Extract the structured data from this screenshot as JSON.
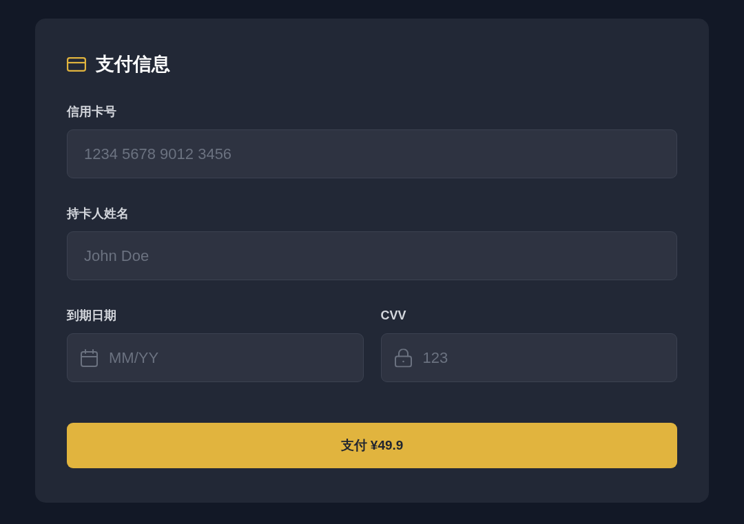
{
  "card": {
    "title": "支付信息",
    "rows": [
      {
        "fields": [
          {
            "label": "信用卡号",
            "placeholder": "1234 5678 9012 3456",
            "kind": "text"
          }
        ]
      },
      {
        "fields": [
          {
            "label": "持卡人姓名",
            "placeholder": "John Doe",
            "kind": "text"
          }
        ]
      },
      {
        "fields": [
          {
            "label": "到期日期",
            "placeholder": "MM/YY",
            "kind": "date"
          },
          {
            "label": "CVV",
            "placeholder": "123",
            "kind": "cvv"
          }
        ]
      }
    ],
    "submit_button": {
      "label": "支付 ¥49.9"
    }
  }
}
